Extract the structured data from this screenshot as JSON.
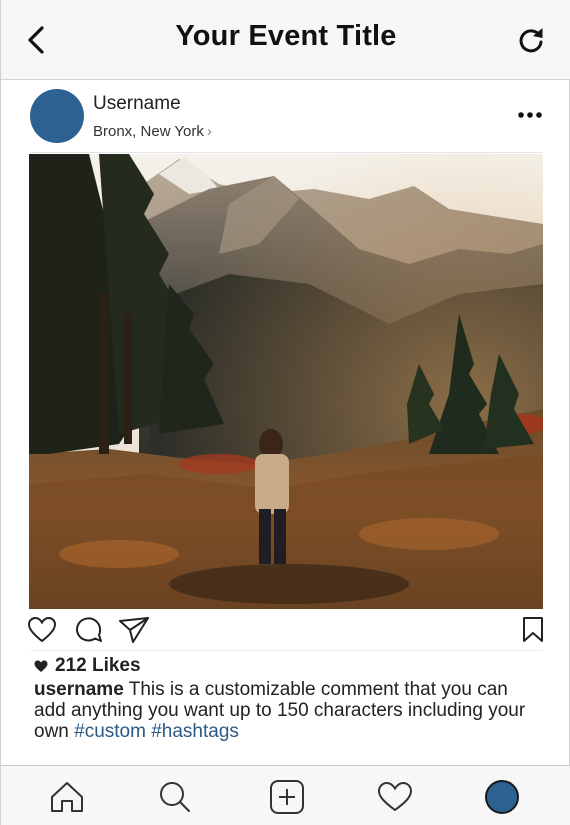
{
  "header": {
    "title": "Your Event Title",
    "back_icon": "chevron-left-icon",
    "refresh_icon": "refresh-icon"
  },
  "post": {
    "username": "Username",
    "location": "Bronx, New York",
    "location_chevron": "›",
    "avatar_color": "#2c6191",
    "more_icon": "ellipsis-icon",
    "photo_description_icon": "mountain-photo"
  },
  "actions": {
    "like_icon": "heart-outline-icon",
    "comment_icon": "comment-bubble-icon",
    "share_icon": "paper-plane-icon",
    "save_icon": "bookmark-icon"
  },
  "likes": {
    "count_text": "212 Likes"
  },
  "caption": {
    "user": "username",
    "text": " This is a customizable comment that you can add anything you want up to 150 characters including your own ",
    "hashtag1": "#custom",
    "space": " ",
    "hashtag2": "#hashtags",
    "hashtag_color": "#2b5a84"
  },
  "bottom_nav": {
    "items": [
      "home-icon",
      "search-icon",
      "add-post-icon",
      "activity-heart-icon",
      "profile-avatar-icon"
    ]
  }
}
